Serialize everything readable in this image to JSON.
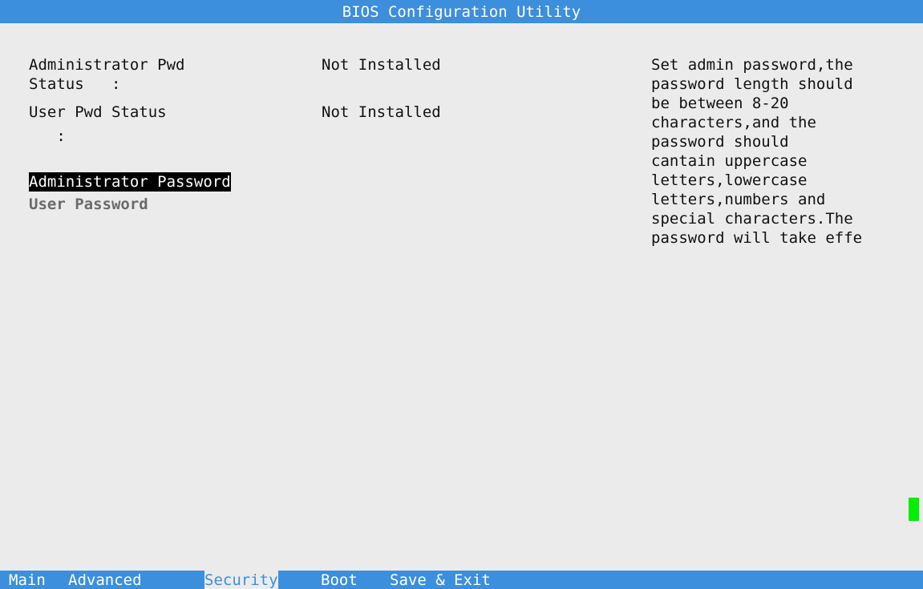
{
  "window": {
    "title": "BIOS Configuration Utility"
  },
  "status": {
    "admin_label_line1": "Administrator Pwd",
    "admin_label_line2": "Status   :",
    "admin_value": "Not Installed",
    "user_label_line1": "User Pwd Status",
    "user_label_line2": "   :",
    "user_value": "Not Installed"
  },
  "menu": {
    "items": [
      {
        "label": "Administrator Password",
        "state": "selected"
      },
      {
        "label": "User Password",
        "state": "disabled"
      }
    ]
  },
  "help": {
    "lines": [
      "Set admin password,the",
      "password length should",
      "be between 8-20",
      "characters,and the",
      "password should",
      "cantain uppercase",
      "letters,lowercase",
      "letters,numbers and",
      "special characters.The",
      "password will take effe"
    ]
  },
  "nav": {
    "tabs": [
      {
        "label": "Main"
      },
      {
        "label": "Advanced"
      },
      {
        "label": "Security",
        "active": true
      },
      {
        "label": "Boot"
      },
      {
        "label": "Save & Exit"
      }
    ]
  },
  "colors": {
    "accent": "#3c8fdc",
    "background": "#ebebeb",
    "cursor": "#00ee00",
    "highlight": "#000000",
    "disabled_text": "#6a6a6a"
  },
  "icons": {
    "cursor": "text-cursor-block"
  }
}
